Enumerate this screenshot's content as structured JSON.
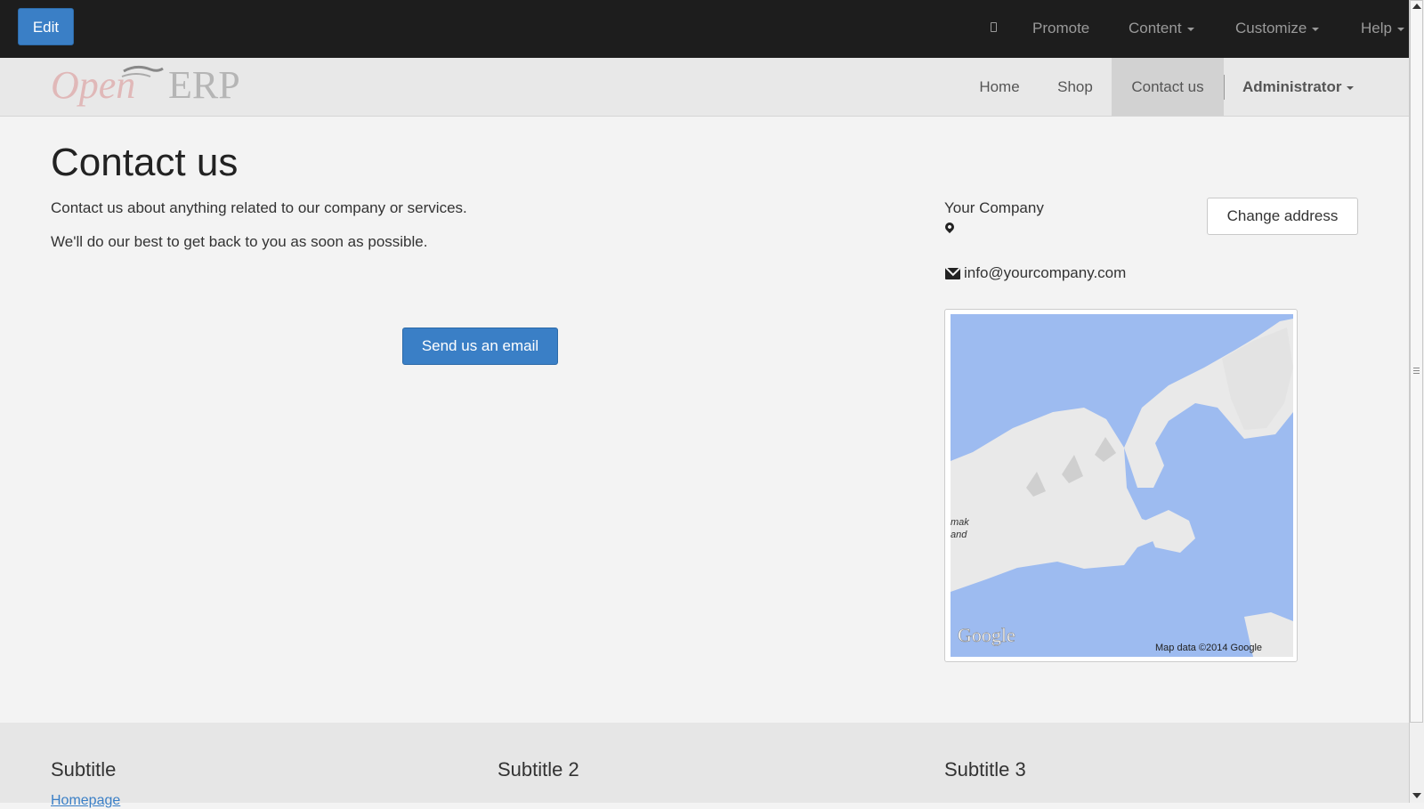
{
  "topbar": {
    "edit_label": "Edit",
    "mobile_icon": "mobile-icon",
    "promote_label": "Promote",
    "content_label": "Content",
    "customize_label": "Customize",
    "help_label": "Help",
    "accent_color": "#3a7fc6",
    "background_color": "#1d1d1d"
  },
  "brand": {
    "logo_text_open": "Open",
    "logo_text_erp": "ERP"
  },
  "nav": {
    "items": [
      {
        "label": "Home"
      },
      {
        "label": "Shop"
      },
      {
        "label": "Contact us",
        "active": true
      }
    ],
    "user_label": "Administrator"
  },
  "main": {
    "title": "Contact us",
    "paragraphs": [
      "Contact us about anything related to our company or services.",
      "We'll do our best to get back to you as soon as possible."
    ],
    "send_button_label": "Send us an email"
  },
  "contact": {
    "company_name": "Your Company",
    "location_icon": "map-marker-icon",
    "change_address_label": "Change address",
    "email_icon": "envelope-icon",
    "email": "info@yourcompany.com"
  },
  "map": {
    "place_label_line1": "mak",
    "place_label_line2": "and",
    "logo": "Google",
    "attribution": "Map data ©2014 Google",
    "water_color": "#9dbbf0",
    "land_color": "#e9e9e9"
  },
  "footer": {
    "subtitles": [
      "Subtitle",
      "Subtitle 2",
      "Subtitle 3"
    ],
    "link_label": "Homepage"
  }
}
